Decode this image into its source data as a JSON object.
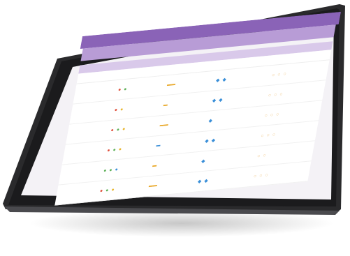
{
  "screen": {
    "topbar": {
      "left": "",
      "right": ""
    },
    "titlebar": {
      "title": "",
      "tools": ""
    },
    "tab": "",
    "columns": [
      "",
      "",
      "",
      "",
      ""
    ],
    "rows": [
      {
        "name": "",
        "detail": ""
      },
      {
        "name": "",
        "detail": ""
      },
      {
        "name": "",
        "detail": ""
      },
      {
        "name": "",
        "detail": ""
      },
      {
        "name": "",
        "detail": ""
      },
      {
        "name": "",
        "detail": ""
      }
    ]
  },
  "colors": {
    "topbar": "#8a63b7",
    "titlebar": "#b89cd6",
    "tab": "#d9c9ea",
    "device_frame": "#2a2a2c"
  },
  "icons": [
    "status-dot-icon",
    "flag-icon",
    "check-icon"
  ]
}
